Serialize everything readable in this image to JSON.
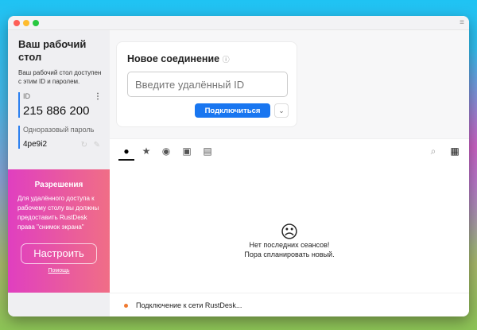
{
  "sidebar": {
    "title": "Ваш рабочий стол",
    "description": "Ваш рабочий стол доступен с этим ID и паролем.",
    "id_label": "ID",
    "id_value": "215 886 200",
    "password_label": "Одноразовый пароль",
    "password_value": "4pe9i2"
  },
  "permissions": {
    "title": "Разрешения",
    "text": "Для удалённого доступа к рабочему столу вы должны предоставить RustDesk права \"снимок экрана\"",
    "button": "Настроить",
    "help": "Помощь"
  },
  "connection": {
    "title": "Новое соединение",
    "help_icon": "?",
    "placeholder": "Введите удалённый ID",
    "connect": "Подключиться"
  },
  "tabs": [
    {
      "name": "recent",
      "icon": "clock-icon",
      "active": true
    },
    {
      "name": "favorites",
      "icon": "star-icon"
    },
    {
      "name": "discovered",
      "icon": "compass-icon"
    },
    {
      "name": "address-book",
      "icon": "contact-icon"
    },
    {
      "name": "devices",
      "icon": "devices-icon"
    }
  ],
  "empty": {
    "line1": "Нет последних сеансов!",
    "line2": "Пора спланировать новый."
  },
  "status": {
    "text": "Подключение к сети RustDesk...",
    "color": "#f07a30"
  },
  "colors": {
    "accent": "#1976f0"
  }
}
